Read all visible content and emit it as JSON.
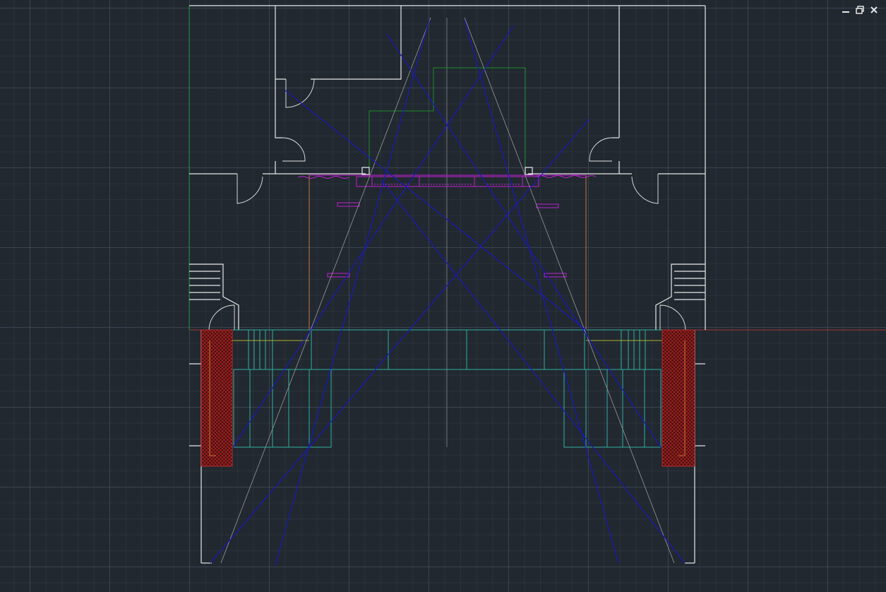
{
  "app": {
    "window_controls": {
      "minimize_icon": "minimize-icon",
      "restore_icon": "restore-icon",
      "close_icon": "close-icon"
    }
  },
  "colors": {
    "background": "#212830",
    "grid_major": "#485260",
    "grid_minor": "#303842",
    "walls": "#e8e8e8",
    "sightlines_blue": "#1a1ab8",
    "sightlines_gray": "#9a9a9a",
    "stage_orange": "#c8783c",
    "screen_magenta": "#c020d0",
    "seating_cyan": "#30b0a0",
    "hatch_red": "#b01818",
    "green_outline": "#1e8c2a",
    "axis_red": "#a03838",
    "yellow": "#b0b030"
  }
}
